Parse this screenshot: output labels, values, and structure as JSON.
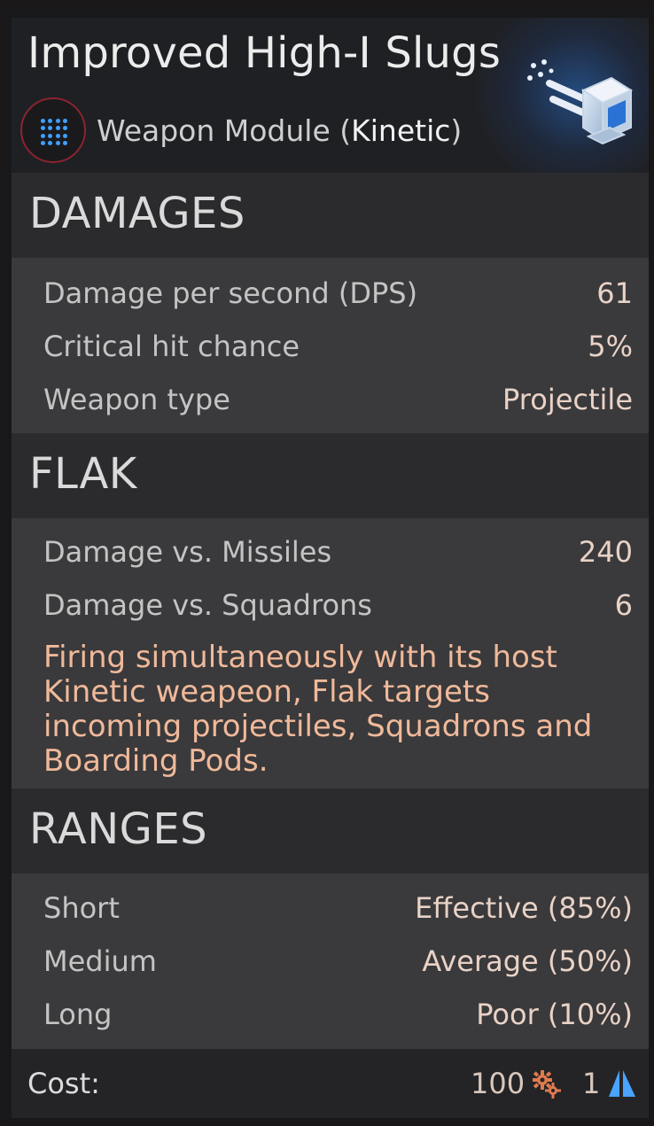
{
  "header": {
    "title": "Improved High-I Slugs",
    "subtitle_prefix": "Weapon Module (",
    "subtitle_type": "Kinetic",
    "subtitle_suffix": ")",
    "icons": [
      "module-dots-icon",
      "kinetic-turret-icon"
    ]
  },
  "damages": {
    "heading": "DAMAGES",
    "rows": [
      {
        "label": "Damage per second (DPS)",
        "value": "61"
      },
      {
        "label": "Critical hit chance",
        "value": "5%"
      },
      {
        "label": "Weapon type",
        "value": "Projectile"
      }
    ]
  },
  "flak": {
    "heading": "FLAK",
    "rows": [
      {
        "label": "Damage vs. Missiles",
        "value": "240"
      },
      {
        "label": "Damage vs. Squadrons",
        "value": "6"
      }
    ],
    "description": "Firing simultaneously with its host Kinetic weapeon, Flak targets incoming projectiles, Squadrons and Boarding Pods."
  },
  "ranges": {
    "heading": "RANGES",
    "rows": [
      {
        "label": "Short",
        "value": "Effective (85%)"
      },
      {
        "label": "Medium",
        "value": "Average (50%)"
      },
      {
        "label": "Long",
        "value": "Poor (10%)"
      }
    ]
  },
  "footer": {
    "cost_label": "Cost:",
    "cost_industry": "100",
    "cost_industry_icon": "gears-icon",
    "cost_slots": "1",
    "cost_slots_icon": "sail-icon"
  },
  "colors": {
    "accent_blue": "#3ea0ff",
    "value_text": "#e9d2c6",
    "description_text": "#f0b99a",
    "module_ring": "#8a2430"
  }
}
